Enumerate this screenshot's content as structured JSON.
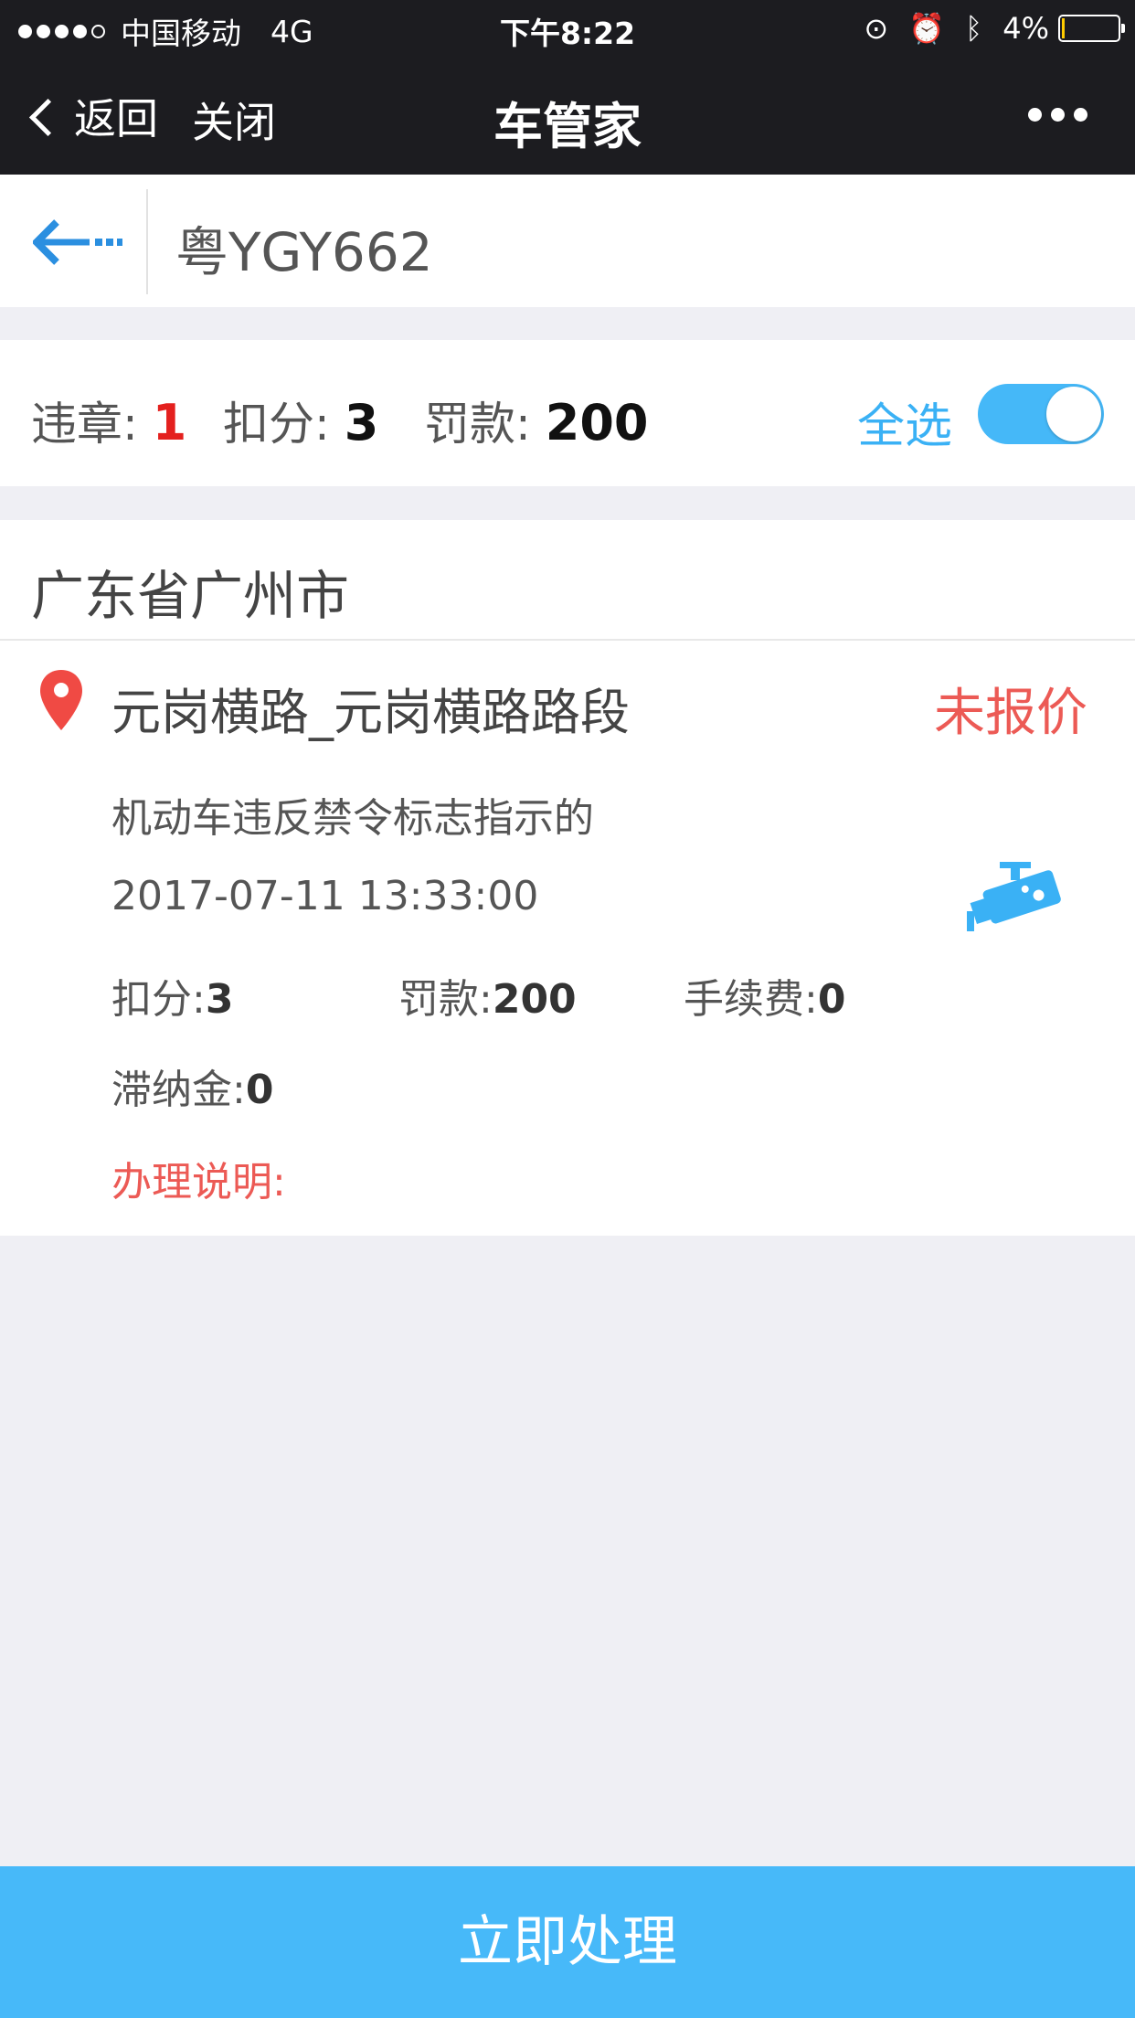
{
  "status_bar": {
    "carrier": "中国移动",
    "network": "4G",
    "time": "下午8:22",
    "battery": "4%",
    "colors": {
      "battery_fill": "#ffcc00"
    }
  },
  "nav": {
    "back_label": "返回",
    "close_label": "关闭",
    "title": "车管家"
  },
  "plate": {
    "number": "粤YGY662"
  },
  "summary": {
    "violation_label": "违章:",
    "violation_count": "1",
    "points_label": "扣分:",
    "points": "3",
    "fine_label": "罚款:",
    "fine": "200",
    "select_all_label": "全选",
    "select_all_on": true
  },
  "region": "广东省广州市",
  "violation": {
    "road": "元岗横路_元岗横路路段",
    "quote_status": "未报价",
    "description": "机动车违反禁令标志指示的",
    "datetime": "2017-07-11 13:33:00",
    "points_label": "扣分:",
    "points": "3",
    "fine_label": "罚款:",
    "fine": "200",
    "fee_label": "手续费:",
    "fee": "0",
    "late_fee_label": "滞纳金:",
    "late_fee": "0",
    "explain_label": "办理说明:",
    "icons": [
      "location-pin-icon",
      "camera-icon"
    ]
  },
  "action": {
    "process_label": "立即处理"
  },
  "colors": {
    "accent": "#47b9f9",
    "alert_red": "#ec5a55",
    "count_red": "#e4201e",
    "nav_bg": "#1c1c20"
  }
}
